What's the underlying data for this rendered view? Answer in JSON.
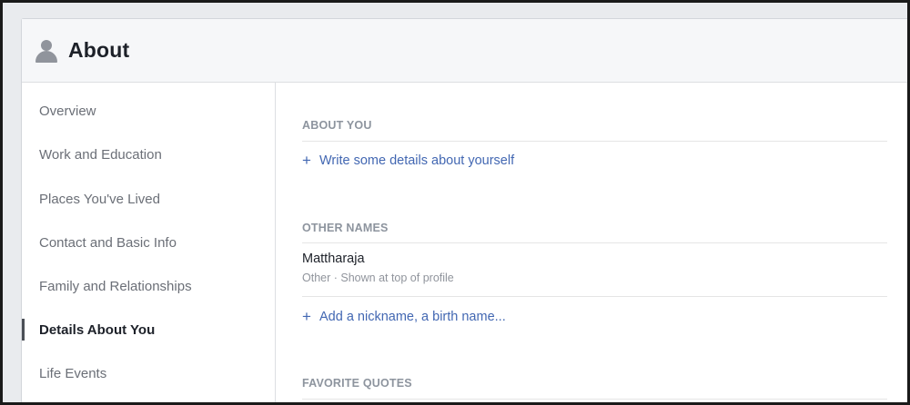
{
  "header": {
    "title": "About",
    "icon": "person-icon"
  },
  "sidebar": {
    "items": [
      {
        "label": "Overview",
        "active": false
      },
      {
        "label": "Work and Education",
        "active": false
      },
      {
        "label": "Places You've Lived",
        "active": false
      },
      {
        "label": "Contact and Basic Info",
        "active": false
      },
      {
        "label": "Family and Relationships",
        "active": false
      },
      {
        "label": "Details About You",
        "active": true
      },
      {
        "label": "Life Events",
        "active": false
      }
    ]
  },
  "main": {
    "about_you": {
      "title": "ABOUT YOU",
      "add_label": "Write some details about yourself"
    },
    "other_names": {
      "title": "OTHER NAMES",
      "name": "Mattharaja",
      "meta": "Other · Shown at top of profile",
      "add_label": "Add a nickname, a birth name..."
    },
    "favorite_quotes": {
      "title": "FAVORITE QUOTES"
    }
  },
  "colors": {
    "link": "#4267b2",
    "active_indicator": "#4b4f56",
    "header_bg": "#f6f7f9"
  }
}
